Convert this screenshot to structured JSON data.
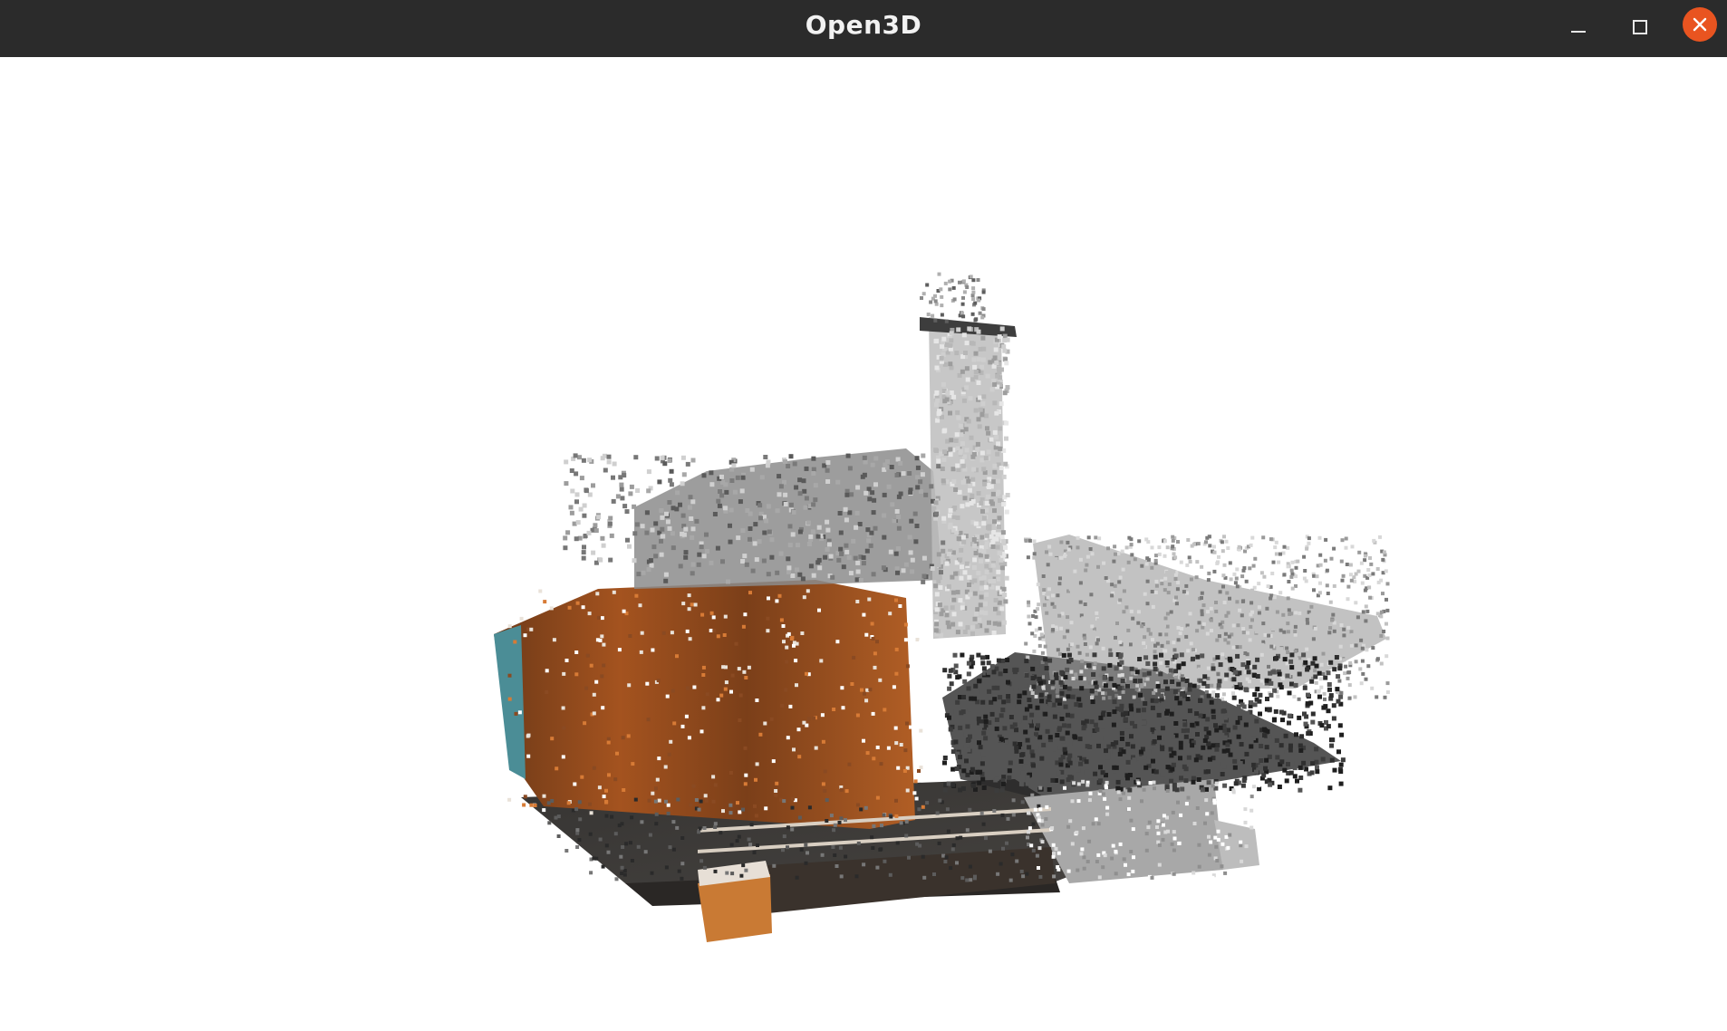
{
  "window": {
    "title": "Open3D",
    "controls": {
      "minimize_icon": "minimize-icon",
      "maximize_icon": "maximize-icon",
      "close_icon": "close-icon",
      "close_color": "#e95420"
    }
  },
  "viewport": {
    "background": "#ffffff",
    "content": "point-cloud"
  }
}
